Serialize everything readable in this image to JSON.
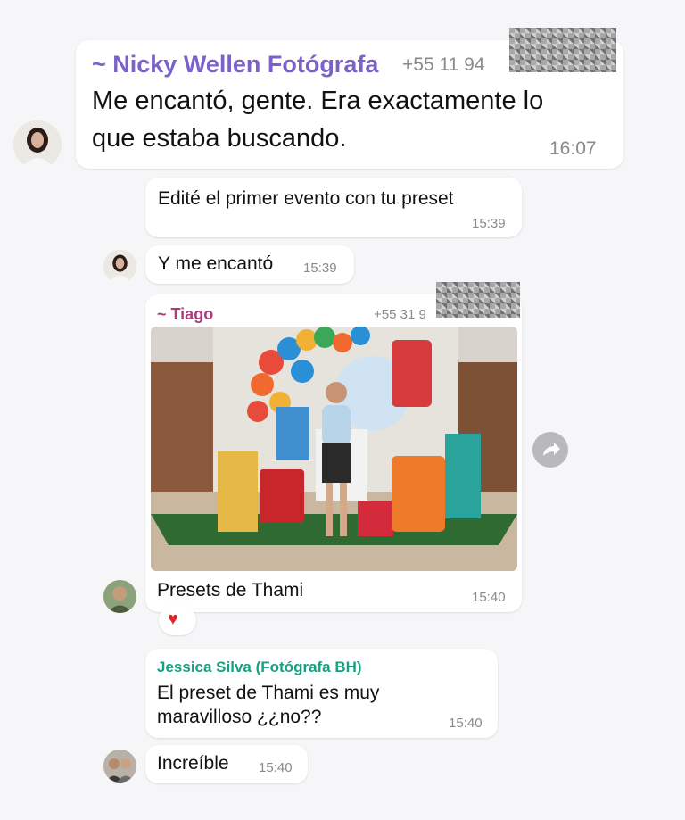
{
  "messages": [
    {
      "sender": "~ Nicky Wellen Fotógrafa",
      "phone": "+55 11 94",
      "text_line1": "Me encantó, gente. Era exactamente lo",
      "text_line2": "que estaba buscando.",
      "time": "16:07"
    },
    {
      "text": "Edité el primer evento con tu preset",
      "time": "15:39"
    },
    {
      "text": "Y me encantó",
      "time": "15:39"
    },
    {
      "sender": "~ Tiago",
      "phone": "+55 31 9",
      "caption": "Presets de Thami",
      "time": "15:40",
      "reaction": "❤️"
    },
    {
      "sender": "Jessica Silva (Fotógrafa BH)",
      "text_line1": "El preset de Thami es muy",
      "text_line2": "maravilloso ¿¿no??",
      "time": "15:40"
    },
    {
      "text": "Increíble",
      "time": "15:40"
    }
  ],
  "colors": {
    "nicky_name": "#7b62c9",
    "tiago_name": "#b03a7a",
    "jessica_name": "#16a085"
  },
  "icons": {
    "forward": "forward-arrow-icon"
  }
}
